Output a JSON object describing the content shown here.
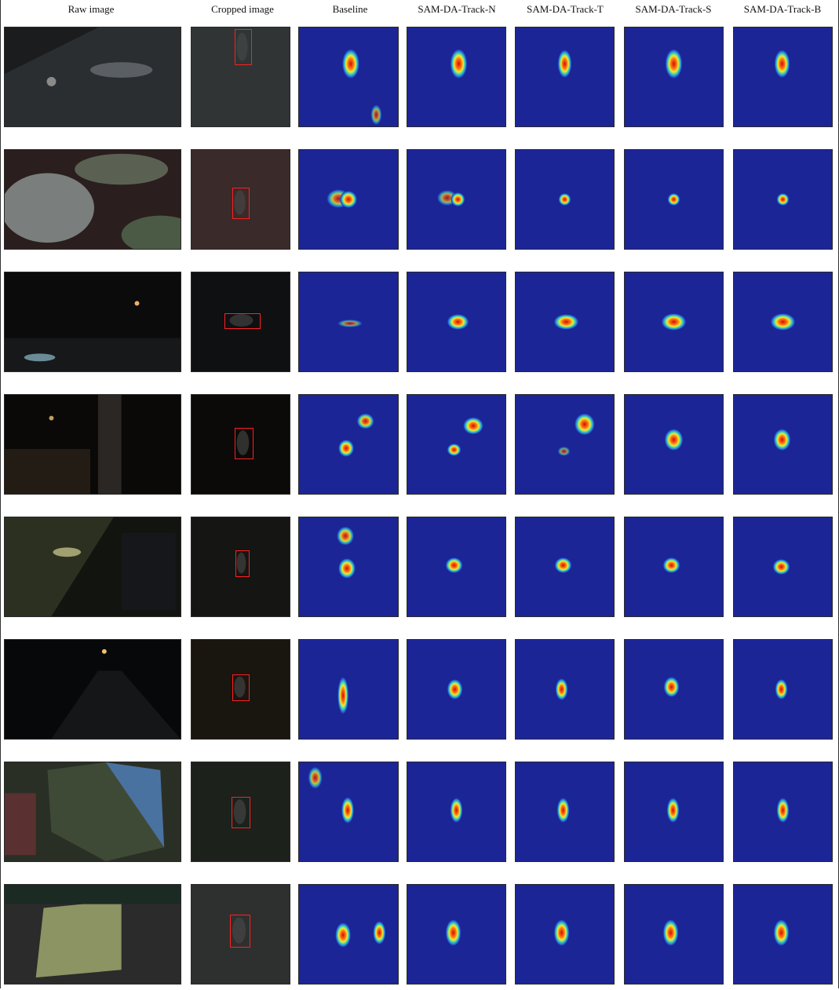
{
  "figure": {
    "columns": [
      {
        "key": "raw",
        "title": "Raw image"
      },
      {
        "key": "crop",
        "title": "Cropped image"
      },
      {
        "key": "baseline",
        "title": "Baseline"
      },
      {
        "key": "n",
        "title": "SAM-DA-Track-N"
      },
      {
        "key": "t",
        "title": "SAM-DA-Track-T"
      },
      {
        "key": "s",
        "title": "SAM-DA-Track-S"
      },
      {
        "key": "b",
        "title": "SAM-DA-Track-B"
      }
    ],
    "row_count": 8,
    "colors": {
      "heat_background": "#1c2596",
      "heat_peak": "#d40a0a",
      "crop_box": "#ff2020",
      "raw_dark": "#0d0d0d"
    }
  }
}
